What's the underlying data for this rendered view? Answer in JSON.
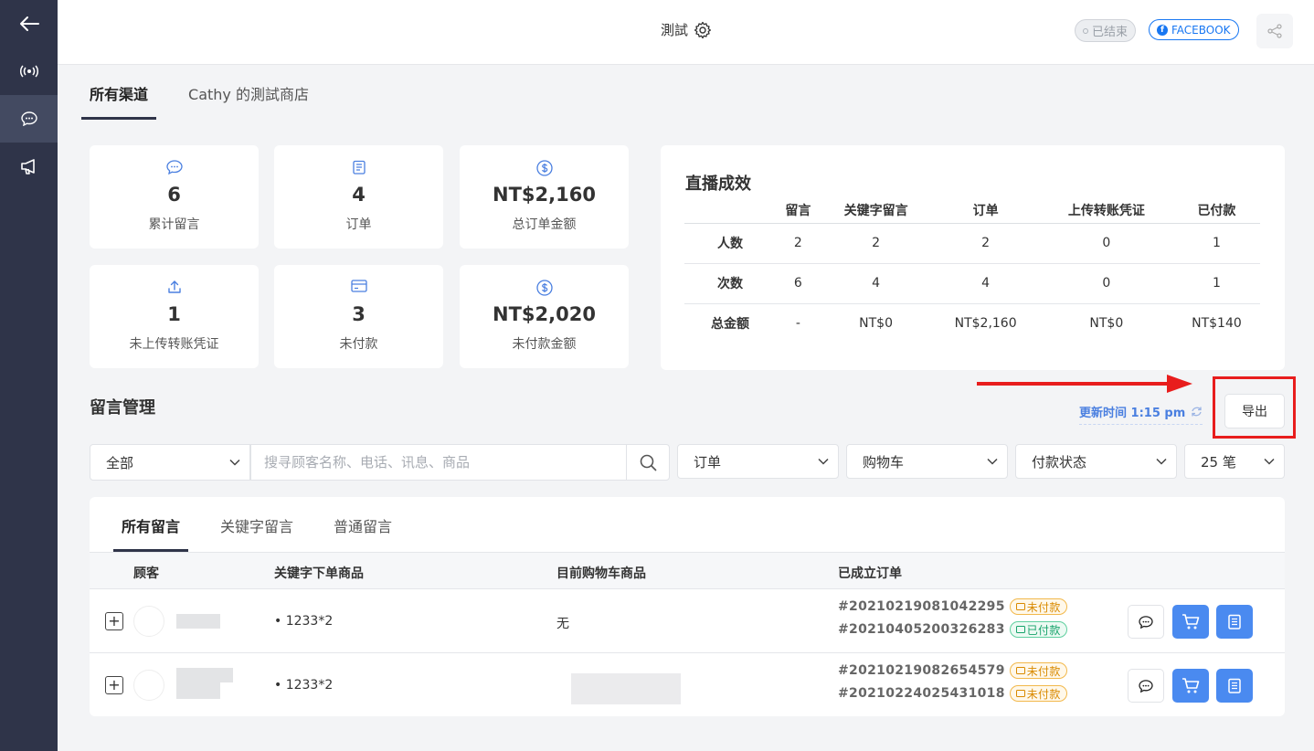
{
  "header": {
    "title": "測試",
    "status_ended": "已结束",
    "platform": "FACEBOOK"
  },
  "channel_tabs": [
    {
      "label": "所有渠道"
    },
    {
      "label": "Cathy 的測試商店"
    }
  ],
  "stats": [
    {
      "icon": "chat-icon",
      "value": "6",
      "label": "累计留言"
    },
    {
      "icon": "clipboard-icon",
      "value": "4",
      "label": "订单"
    },
    {
      "icon": "dollar-icon",
      "value": "NT$2,160",
      "label": "总订单金额"
    },
    {
      "icon": "upload-icon",
      "value": "1",
      "label": "未上传转账凭证"
    },
    {
      "icon": "credit-card-icon",
      "value": "3",
      "label": "未付款"
    },
    {
      "icon": "dollar-icon",
      "value": "NT$2,020",
      "label": "未付款金额"
    }
  ],
  "performance": {
    "title": "直播成效",
    "columns": [
      "留言",
      "关键字留言",
      "订单",
      "上传转账凭证",
      "已付款"
    ],
    "rows": [
      {
        "label": "人数",
        "cells": [
          "2",
          "2",
          "2",
          "0",
          "1"
        ]
      },
      {
        "label": "次数",
        "cells": [
          "6",
          "4",
          "4",
          "0",
          "1"
        ]
      },
      {
        "label": "总金额",
        "cells": [
          "-",
          "NT$0",
          "NT$2,160",
          "NT$0",
          "NT$140"
        ]
      }
    ]
  },
  "messages": {
    "title": "留言管理",
    "updated_label": "更新时间 1:15 pm",
    "export_label": "导出",
    "filters": {
      "scope": "全部",
      "search_placeholder": "搜寻顾客名称、电话、讯息、商品",
      "order": "订单",
      "cart": "购物车",
      "payment": "付款状态",
      "page_size": "25 笔"
    },
    "tabs": [
      {
        "label": "所有留言"
      },
      {
        "label": "关键字留言"
      },
      {
        "label": "普通留言"
      }
    ],
    "columns": {
      "customer": "顾客",
      "keyword_items": "关键字下单商品",
      "cart_items": "目前购物车商品",
      "orders": "已成立订单"
    },
    "rows": [
      {
        "keyword_item": "• 1233*2",
        "cart_item": "无",
        "orders": [
          {
            "id": "#20210219081042295",
            "status": "未付款"
          },
          {
            "id": "#20210405200326283",
            "status": "已付款"
          }
        ]
      },
      {
        "keyword_item": "• 1233*2",
        "cart_item": "",
        "orders": [
          {
            "id": "#20210219082654579",
            "status": "未付款"
          },
          {
            "id": "#20210224025431018",
            "status": "未付款"
          }
        ]
      }
    ]
  },
  "colors": {
    "sidebar": "#2f3449",
    "accent": "#4a8af0",
    "highlight": "#e81d1d",
    "unpaid": "#d98a00",
    "paid": "#17a36b"
  }
}
